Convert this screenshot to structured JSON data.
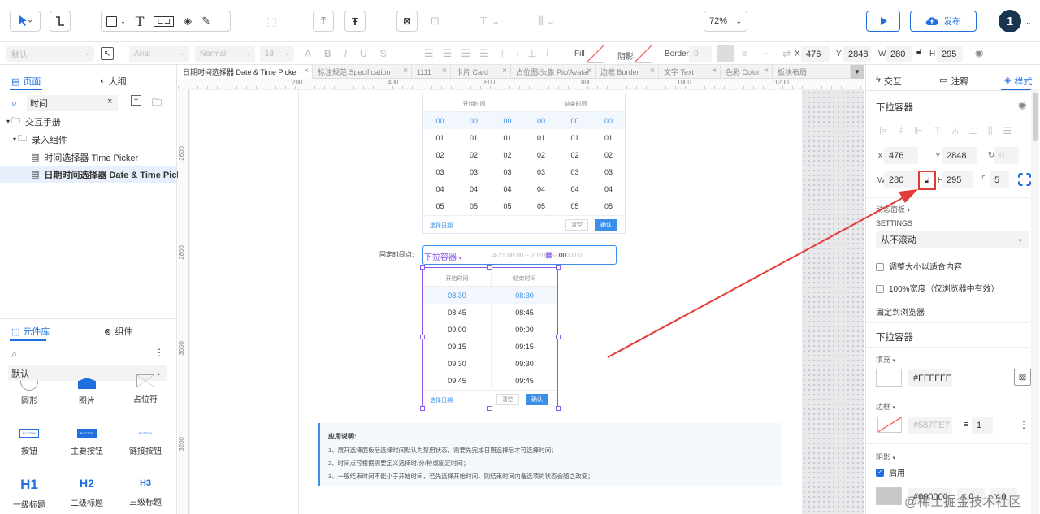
{
  "toolbar": {
    "zoom": "72%",
    "publish_label": "发布",
    "avatar_text": "1"
  },
  "format_bar": {
    "font_placeholder": "默认",
    "font_family": "Arial",
    "font_weight": "Normal",
    "font_size": "13",
    "fill_label": "Fill",
    "shadow_label": "阴影",
    "border_label": "Border",
    "border_value": "0",
    "x_label": "X",
    "x_value": "476",
    "y_label": "Y",
    "y_value": "2848",
    "w_label": "W",
    "w_value": "280",
    "h_label": "H",
    "h_value": "295"
  },
  "left_panel": {
    "tab_pages": "页面",
    "tab_outline": "大纲",
    "search_value": "时间",
    "tree": [
      {
        "label": "交互手册",
        "level": 0
      },
      {
        "label": "录入组件",
        "level": 1
      },
      {
        "label": "时间选择器 Time Picker",
        "level": 2
      },
      {
        "label": "日期时间选择器 Date & Time Picker",
        "level": 2
      }
    ],
    "tab_library": "元件库",
    "tab_components": "组件",
    "library_select": "默认",
    "lib_items": [
      {
        "label": "圆形",
        "icon": "circle-icon"
      },
      {
        "label": "图片",
        "icon": "image-icon"
      },
      {
        "label": "占位符",
        "icon": "placeholder-icon"
      },
      {
        "label": "按钮",
        "icon": "button-icon",
        "text": "BUTTON"
      },
      {
        "label": "主要按钮",
        "icon": "primary-button-icon",
        "text": "BUTTON"
      },
      {
        "label": "链接按钮",
        "icon": "link-button-icon",
        "text": "BUTTON"
      },
      {
        "label": "一级标题",
        "icon": "h1-icon",
        "text": "H1"
      },
      {
        "label": "二级标题",
        "icon": "h2-icon",
        "text": "H2"
      },
      {
        "label": "三级标题",
        "icon": "h3-icon",
        "text": "H3"
      }
    ]
  },
  "canvas": {
    "tabs": [
      "日期时间选择器 Date & Time Picker",
      "标注规范 Specification",
      "1111",
      "卡片 Card",
      "占位图/头像 Pic/Avatar",
      "边框 Border",
      "文字 Text",
      "色彩 Color",
      "板块布局"
    ],
    "ruler_h": [
      "200",
      "400",
      "600",
      "800",
      "1000",
      "1200"
    ],
    "ruler_v": [
      "2600",
      "2800",
      "3000",
      "3200"
    ],
    "picker1": {
      "col_start": "开始时间",
      "col_end": "结束时间",
      "rows": [
        [
          "00",
          "00",
          "00",
          "00",
          "00",
          "00"
        ],
        [
          "01",
          "01",
          "01",
          "01",
          "01",
          "01"
        ],
        [
          "02",
          "02",
          "02",
          "02",
          "02",
          "02"
        ],
        [
          "03",
          "03",
          "03",
          "03",
          "03",
          "03"
        ],
        [
          "04",
          "04",
          "04",
          "04",
          "04",
          "04"
        ],
        [
          "05",
          "05",
          "05",
          "05",
          "05",
          "05"
        ]
      ],
      "select_date": "选择日期",
      "clear": "清空",
      "confirm": "确认"
    },
    "fixed_label": "固定时间点:",
    "input_text": "4-21 00:00 ~ 2020-05-30 00:00",
    "input_tail": "00",
    "dropdown_tag": "下拉容器",
    "picker2": {
      "col_start": "开始时间",
      "col_end": "结束时间",
      "rows": [
        [
          "08:30",
          "08:30"
        ],
        [
          "08:45",
          "08:45"
        ],
        [
          "09:00",
          "09:00"
        ],
        [
          "09:15",
          "09:15"
        ],
        [
          "09:30",
          "09:30"
        ],
        [
          "09:45",
          "09:45"
        ]
      ],
      "select_date": "选择日期",
      "clear": "清空",
      "confirm": "确认"
    },
    "notes": {
      "title": "应用说明:",
      "lines": [
        "1、展开选择面板后选择时间默认为禁用状态，需要先完成日期选择后才可选择时间；",
        "2、时间点可根据需要定义选择时/分/秒或固定时间；",
        "3、一般结束时间不能小于开始时间，若先选择开始时间，则结束时间内备选项的状态会随之改变；"
      ]
    }
  },
  "right_panel": {
    "tab_interact": "交互",
    "tab_notes": "注释",
    "tab_style": "样式",
    "component_title": "下拉容器",
    "x_value": "476",
    "y_value": "2848",
    "r_value": "0",
    "w_value": "280",
    "h_value": "295",
    "radius_value": "5",
    "state_panel": "动态面板",
    "settings": "SETTINGS",
    "scroll_value": "从不滚动",
    "fit_content": "调整大小以适合内容",
    "full_width": "100%宽度（仅浏览器中有效）",
    "pin_browser": "固定到浏览器",
    "section2": "下拉容器",
    "fill_label": "填充",
    "fill_value": "#FFFFFF",
    "border_label": "边框",
    "border_value": "#587FE7",
    "border_width": "1",
    "shadow_label": "阴影",
    "shadow_enable": "启用",
    "shadow_value": "#000000",
    "shadow_x": "0",
    "shadow_y": "0"
  },
  "watermark": "@稀土掘金技术社区",
  "colors": {
    "accent": "#1f6fe0",
    "selection": "#8a5ae8",
    "annotation": "#e53935"
  }
}
